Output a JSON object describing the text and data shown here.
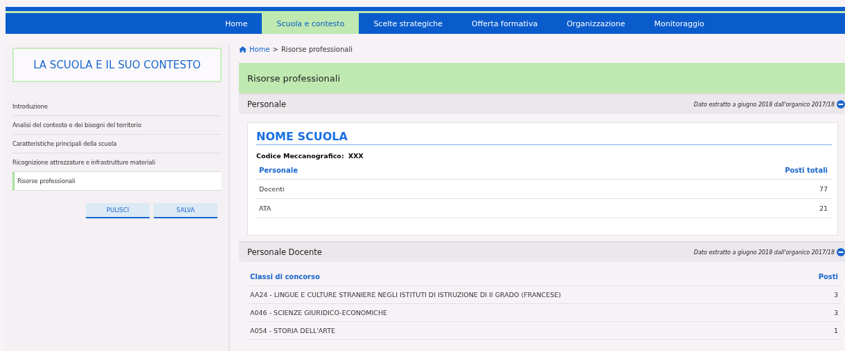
{
  "nav": [
    {
      "label": "Home",
      "selected": false
    },
    {
      "label": "Scuola e contesto",
      "selected": true
    },
    {
      "label": "Scelte strategiche",
      "selected": false
    },
    {
      "label": "Offerta formativa",
      "selected": false
    },
    {
      "label": "Organizzazione",
      "selected": false
    },
    {
      "label": "Monitoraggio",
      "selected": false
    }
  ],
  "sidebar": {
    "title": "LA SCUOLA E IL SUO CONTESTO",
    "items": [
      {
        "label": "Introduzione",
        "selected": false
      },
      {
        "label": "Analisi del contesto e dei bisogni del territorio",
        "selected": false
      },
      {
        "label": "Caratteristiche principali della scuola",
        "selected": false
      },
      {
        "label": "Ricognizione attrezzature e infrastrutture materiali",
        "selected": false
      },
      {
        "label": "Risorse professionali",
        "selected": true
      }
    ],
    "buttons": [
      "PULISCI",
      "SALVA"
    ]
  },
  "breadcrumb": {
    "home": "Home",
    "separator": ">",
    "current": "Risorse professionali"
  },
  "page_title": "Risorse professionali",
  "sections": [
    {
      "title": "Personale",
      "note": "Dato estratto a giugno 2018 dall'organico 2017/18",
      "school_name": "NOME SCUOLA",
      "code_label": "Codice Meccanografico:",
      "code_value": "XXX",
      "columns": [
        "Personale",
        "Posti totali"
      ],
      "rows": [
        [
          "Docenti",
          "77"
        ],
        [
          "ATA",
          "21"
        ]
      ]
    },
    {
      "title": "Personale Docente",
      "note": "Dato estratto a giugno 2018 dall'organico 2017/18",
      "columns": [
        "Classi di concorso",
        "Posti"
      ],
      "rows": [
        [
          "AA24 - LINGUE E CULTURE STRANIERE NEGLI ISTITUTI DI ISTRUZIONE DI II GRADO (FRANCESE)",
          "3"
        ],
        [
          "A046 - SCIENZE GIURIDICO-ECONOMICHE",
          "3"
        ],
        [
          "A054 - STORIA DELL'ARTE",
          "1"
        ]
      ]
    }
  ]
}
